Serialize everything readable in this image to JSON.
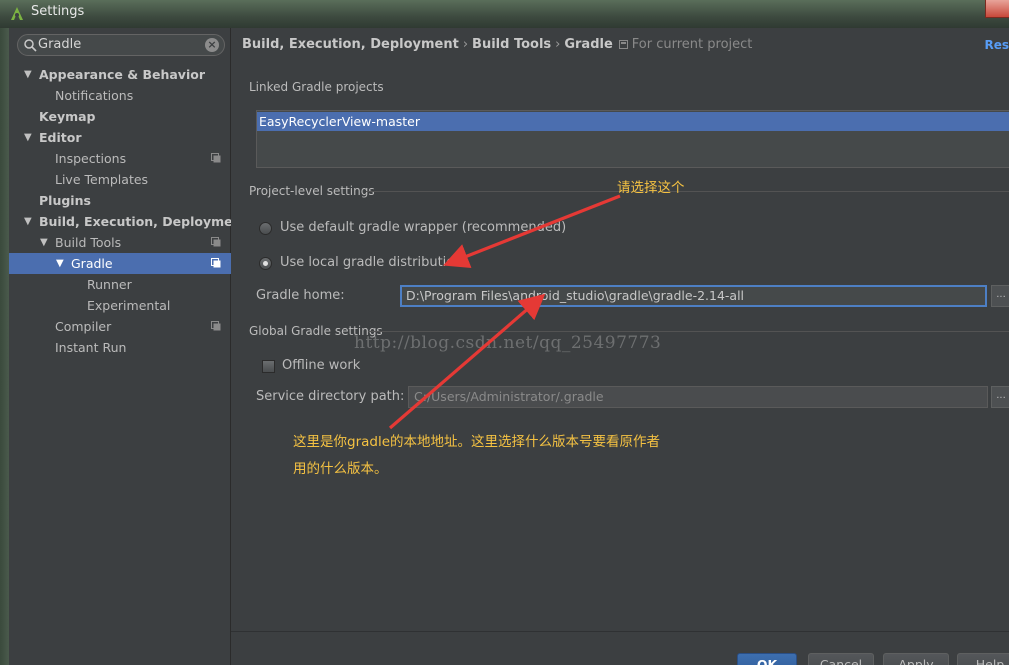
{
  "window": {
    "title": "Settings"
  },
  "search": {
    "value": "Gradle",
    "clear_glyph": "×"
  },
  "tree": [
    {
      "label": "Appearance & Behavior",
      "bold": true,
      "arrow": "▼",
      "indent": 0
    },
    {
      "label": "Notifications",
      "bold": false,
      "arrow": "",
      "indent": 1
    },
    {
      "label": "Keymap",
      "bold": true,
      "arrow": "",
      "indent": 0
    },
    {
      "label": "Editor",
      "bold": true,
      "arrow": "▼",
      "indent": 0
    },
    {
      "label": "Inspections",
      "bold": false,
      "arrow": "",
      "indent": 1,
      "copy_icon": true
    },
    {
      "label": "Live Templates",
      "bold": false,
      "arrow": "",
      "indent": 1
    },
    {
      "label": "Plugins",
      "bold": true,
      "arrow": "",
      "indent": 0
    },
    {
      "label": "Build, Execution, Deployment",
      "bold": true,
      "arrow": "▼",
      "indent": 0
    },
    {
      "label": "Build Tools",
      "bold": false,
      "arrow": "▼",
      "indent": 1,
      "copy_icon": true
    },
    {
      "label": "Gradle",
      "bold": false,
      "arrow": "▼",
      "indent": 2,
      "copy_icon": true,
      "selected": true
    },
    {
      "label": "Runner",
      "bold": false,
      "arrow": "",
      "indent": 3
    },
    {
      "label": "Experimental",
      "bold": false,
      "arrow": "",
      "indent": 3
    },
    {
      "label": "Compiler",
      "bold": false,
      "arrow": "",
      "indent": 1,
      "copy_icon": true
    },
    {
      "label": "Instant Run",
      "bold": false,
      "arrow": "",
      "indent": 1
    }
  ],
  "breadcrumb": {
    "part1": "Build, Execution, Deployment",
    "part2": "Build Tools",
    "part3": "Gradle",
    "separator": "›",
    "scope": "For current project"
  },
  "reset_label": "Res",
  "linked": {
    "title": "Linked Gradle projects",
    "items": [
      "EasyRecyclerView-master"
    ]
  },
  "project_level": {
    "title": "Project-level settings",
    "option_default": "Use default gradle wrapper (recommended)",
    "option_local": "Use local gradle distribution",
    "gradle_home_label": "Gradle home:",
    "gradle_home_value": "D:\\Program Files\\android_studio\\gradle\\gradle-2.14-all",
    "browse_label": "..."
  },
  "global": {
    "title": "Global Gradle settings",
    "offline_label": "Offline work",
    "service_dir_label": "Service directory path:",
    "service_dir_value": "C:/Users/Administrator/.gradle",
    "browse_label": "..."
  },
  "watermark": "http://blog.csdn.net/qq_25497773",
  "annotations": {
    "choose_this": "请选择这个",
    "explain_line1": "这里是你gradle的本地地址。这里选择什么版本号要看原作者",
    "explain_line2": "用的什么版本。"
  },
  "buttons": {
    "ok": "OK",
    "cancel": "Cancel",
    "apply": "Apply",
    "help": "Help"
  },
  "colors": {
    "background": "#3c3f41",
    "selection": "#4b6eaf",
    "annotation": "#f5c242",
    "arrow": "#e53935",
    "link": "#589df6"
  }
}
